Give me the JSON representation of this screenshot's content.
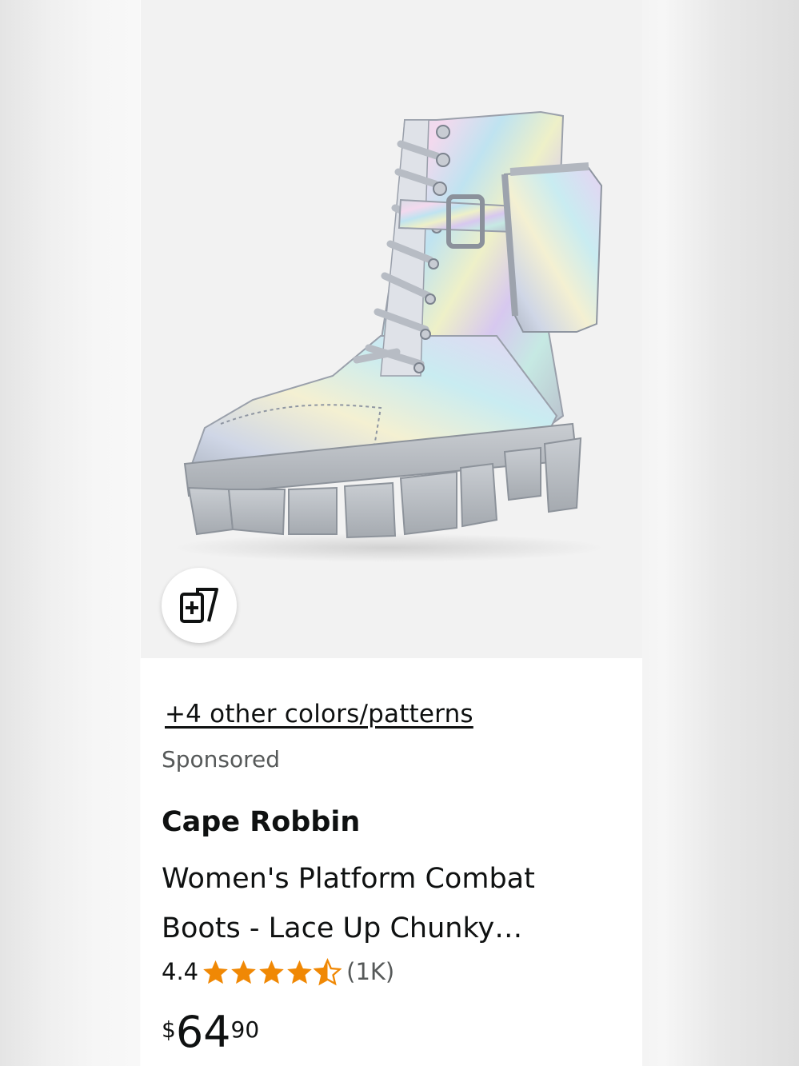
{
  "product": {
    "image_alt": "Holographic silver platform combat boot with pouch",
    "colors_link": "+4 other colors/patterns",
    "sponsored": "Sponsored",
    "brand": "Cape Robbin",
    "title_line1": "Women's Platform Combat",
    "title_line2": "Boots - Lace Up Chunky…",
    "rating": "4.4",
    "rating_value": 4.4,
    "review_count": "(1K)",
    "price": {
      "symbol": "$",
      "whole": "64",
      "fraction": "90"
    }
  },
  "colors": {
    "star": "#f08804",
    "text_primary": "#0f1111",
    "text_secondary": "#565959"
  },
  "icons": {
    "compare": "add-to-compare-icon",
    "star_full": "star-full-icon",
    "star_half": "star-half-icon"
  }
}
